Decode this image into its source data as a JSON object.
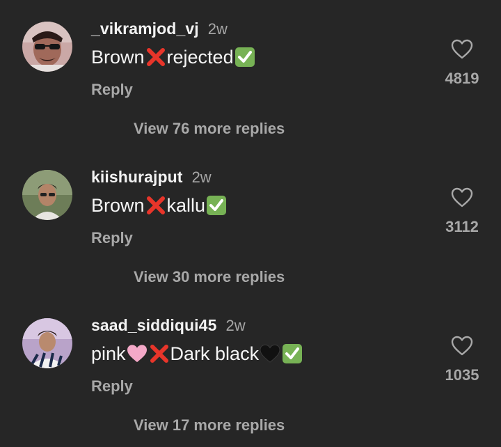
{
  "comments": [
    {
      "username": "_vikramjod_vj",
      "time": "2w",
      "text_parts": [
        "Brown ",
        " rejected "
      ],
      "reply_label": "Reply",
      "likes": "4819",
      "view_replies": "View 76 more replies",
      "avatar_icon": "profile-photo-sunglasses"
    },
    {
      "username": "kiishurajput",
      "time": "2w",
      "text_parts": [
        "Brown ",
        " kallu "
      ],
      "reply_label": "Reply",
      "likes": "3112",
      "view_replies": "View 30 more replies",
      "avatar_icon": "profile-photo-outdoor"
    },
    {
      "username": "saad_siddiqui45",
      "time": "2w",
      "text_parts": [
        "pink ",
        " ",
        " Dark black "
      ],
      "reply_label": "Reply",
      "likes": "1035",
      "view_replies": "View 17 more replies",
      "avatar_icon": "profile-photo-striped"
    }
  ],
  "colors": {
    "background": "#262626",
    "primary_text": "#f5f5f5",
    "secondary_text": "#a8a8a8",
    "cross_red": "#e8352a",
    "check_green": "#77b255",
    "heart_pink": "#f4a9c8"
  },
  "icons": {
    "cross": "cross-mark-icon",
    "check": "check-mark-button-icon",
    "pink_heart": "pink-heart-icon",
    "black_heart": "black-heart-icon",
    "like": "heart-outline-icon"
  }
}
